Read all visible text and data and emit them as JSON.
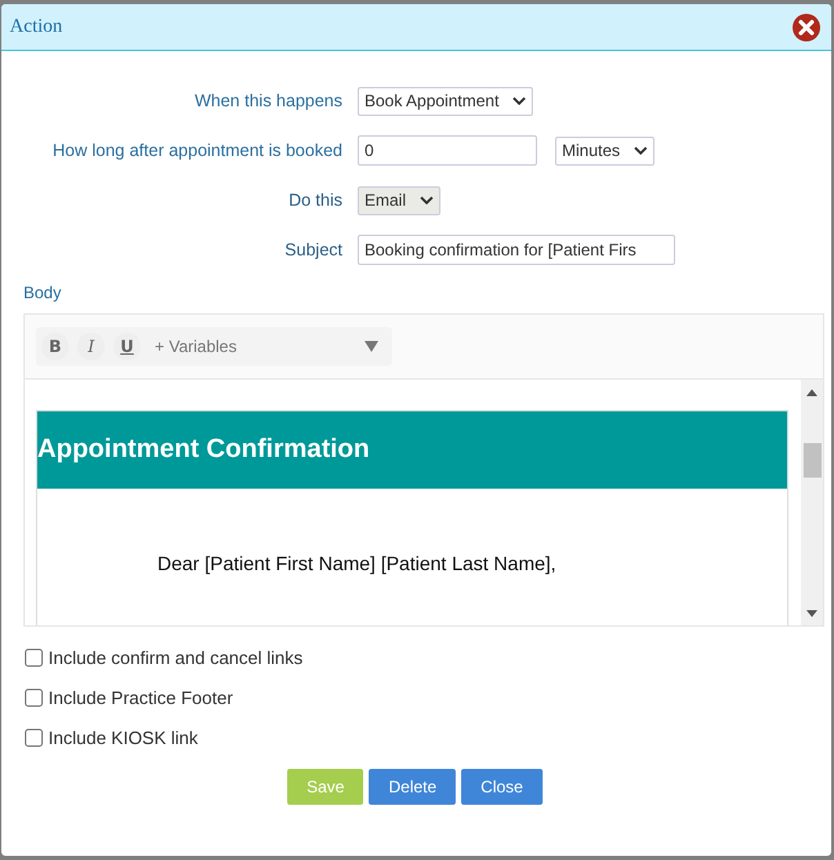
{
  "window": {
    "title": "Action"
  },
  "form": [
    {
      "label": "When this happens",
      "kind": "select",
      "value": "Book Appointment"
    },
    {
      "label": "How long after appointment is booked",
      "kind": "number",
      "value": "0",
      "unit": "Minutes"
    },
    {
      "label": "Do this",
      "kind": "select-grey",
      "value": "Email"
    },
    {
      "label": "Subject",
      "kind": "text",
      "value": "Booking confirmation for [Patient Firs"
    }
  ],
  "body": {
    "label": "Body",
    "toolbar": [
      "B",
      "I",
      "U"
    ],
    "variables": "+ Variables",
    "heading": "Appointment Confirmation",
    "greeting": "Dear [Patient First Name] [Patient Last Name],"
  },
  "options": [
    {
      "label": "Include confirm and cancel links",
      "checked": false
    },
    {
      "label": "Include Practice Footer",
      "checked": false
    },
    {
      "label": "Include KIOSK link",
      "checked": false
    }
  ],
  "buttons": [
    {
      "label": "Save",
      "kind": "success"
    },
    {
      "label": "Delete",
      "kind": "primary"
    },
    {
      "label": "Close",
      "kind": "primary"
    }
  ]
}
